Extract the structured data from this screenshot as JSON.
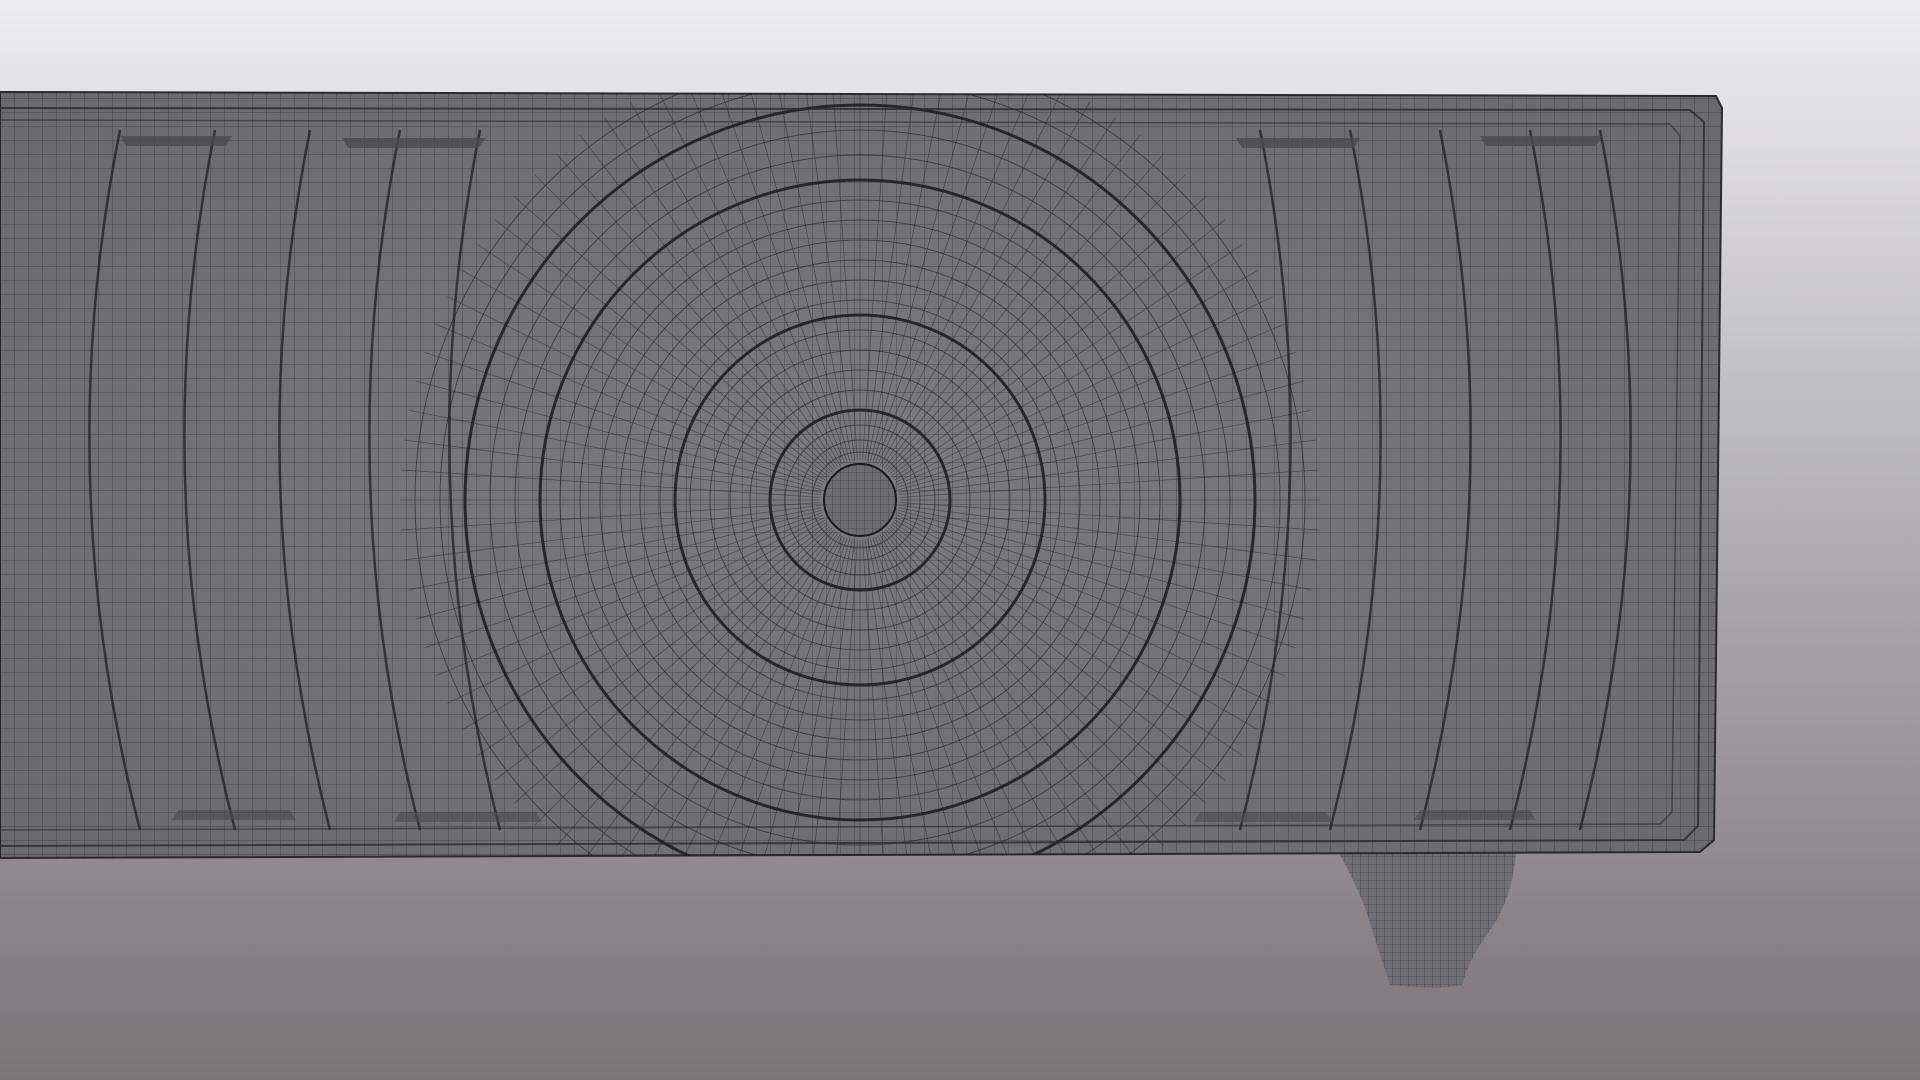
{
  "scene": {
    "subject": "wireframe-furniture-panel",
    "background_top": "#eeedf2",
    "background_mid": "#a9a6ae",
    "background_bottom": "#7b7477",
    "surface_color": "#737379",
    "surface_light": "#8a8a90",
    "surface_dark": "#5b5b60",
    "wire_color": "#1a1a1e"
  }
}
